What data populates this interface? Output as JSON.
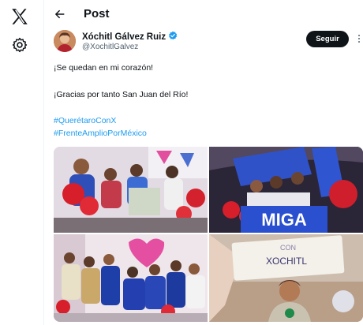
{
  "app": {
    "logo_icon": "x-logo-icon",
    "settings_icon": "gear-icon"
  },
  "header": {
    "back_icon": "arrow-left-icon",
    "title": "Post"
  },
  "author": {
    "display_name": "Xóchitl Gálvez Ruiz",
    "verified_icon": "verified-badge-icon",
    "verified_color": "#1d9bf0",
    "handle": "@XochitlGalvez",
    "follow_label": "Seguir",
    "more_icon": "more-vertical-icon"
  },
  "post": {
    "line1": "¡Se quedan en mi corazón!",
    "line2": "¡Gracias por tanto San Juan del Río!",
    "hashtags": [
      "#QuerétaroConX",
      "#FrenteAmplioPorMéxico"
    ],
    "link_color": "#1d9bf0"
  },
  "media": {
    "photos": [
      {
        "name": "photo-women-with-heart-balloons"
      },
      {
        "name": "photo-crowd-with-amiga-banner",
        "banner_text": "MIGA"
      },
      {
        "name": "photo-group-in-blue-shirts"
      },
      {
        "name": "photo-woman-holding-sign",
        "sign_text": "XOCHITL"
      }
    ]
  }
}
